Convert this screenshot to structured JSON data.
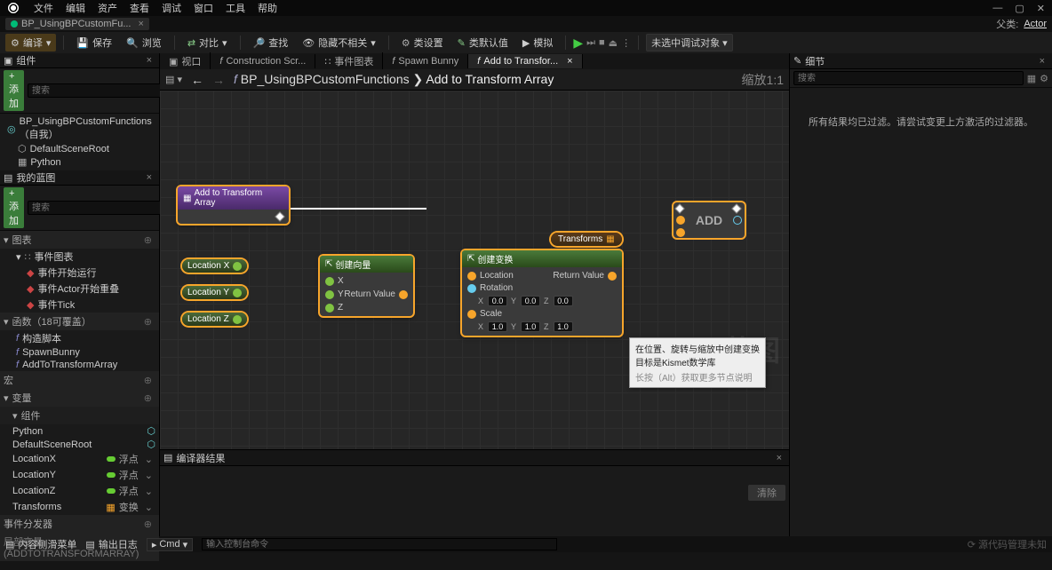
{
  "titlebar": {
    "menus": [
      "文件",
      "编辑",
      "资产",
      "查看",
      "调试",
      "窗口",
      "工具",
      "帮助"
    ],
    "tab_title": "BP_UsingBPCustomFu...",
    "parent_label": "父类:",
    "parent_value": "Actor"
  },
  "toolbar": {
    "compile": "编译",
    "save": "保存",
    "browse": "浏览",
    "diff": "对比",
    "find": "查找",
    "hide_unrelated": "隐藏不相关",
    "class_settings": "类设置",
    "class_defaults": "类默认值",
    "simulate": "模拟",
    "debug_dropdown": "未选中调试对象"
  },
  "components_panel": {
    "title": "组件",
    "add": "+ 添加",
    "search_placeholder": "搜索",
    "root": "BP_UsingBPCustomFunctions （自我）",
    "items": [
      {
        "name": "DefaultSceneRoot",
        "icon": "scene-root"
      },
      {
        "name": "Python",
        "icon": "python"
      }
    ]
  },
  "my_blueprint_panel": {
    "title": "我的蓝图",
    "add": "+ 添加",
    "search_placeholder": "搜索",
    "sections": {
      "graphs": "图表",
      "event_graph": "事件图表",
      "events": [
        "事件开始运行",
        "事件Actor开始重叠",
        "事件Tick"
      ],
      "functions": "函数（18可覆盖）",
      "func_items": [
        "构造脚本",
        "SpawnBunny",
        "AddToTransformArray"
      ],
      "macros": "宏",
      "vars": "变量",
      "components_hdr": "组件",
      "component_vars": [
        {
          "name": "Python",
          "type": "",
          "icon": "py-comp"
        },
        {
          "name": "DefaultSceneRoot",
          "type": "",
          "icon": "scene-comp"
        }
      ],
      "float_vars": [
        {
          "name": "LocationX",
          "type": "浮点"
        },
        {
          "name": "LocationY",
          "type": "浮点"
        },
        {
          "name": "LocationZ",
          "type": "浮点"
        }
      ],
      "transform_var": {
        "name": "Transforms",
        "type": "变换"
      },
      "dispatchers": "事件分发器",
      "local_vars": "局部变量 (ADDTOTRANSFORMARRAY)"
    }
  },
  "graph": {
    "tabs": [
      {
        "label": "视口",
        "icon": "viewport"
      },
      {
        "label": "Construction Scr...",
        "icon": "func"
      },
      {
        "label": "事件图表",
        "icon": "graph"
      },
      {
        "label": "Spawn Bunny",
        "icon": "func"
      },
      {
        "label": "Add to Transfor...",
        "icon": "func",
        "active": true
      }
    ],
    "breadcrumb_root": "BP_UsingBPCustomFunctions",
    "breadcrumb_leaf": "Add to Transform Array",
    "zoom": "缩放1:1",
    "watermark": "蓝图",
    "nodes": {
      "entry": {
        "title": "Add to Transform Array"
      },
      "locx": "Location X",
      "locy": "Location Y",
      "locz": "Location Z",
      "make_vector": {
        "title": "创建向量",
        "x": "X",
        "y": "Y",
        "z": "Z",
        "out": "Return Value"
      },
      "make_transform": {
        "title": "创建变换",
        "location": "Location",
        "rotation": "Rotation",
        "scale": "Scale",
        "out": "Return Value",
        "rot": {
          "x": "0.0",
          "y": "0.0",
          "z": "0.0"
        },
        "scl": {
          "x": "1.0",
          "y": "1.0",
          "z": "1.0"
        }
      },
      "transforms": "Transforms",
      "add": "ADD"
    },
    "tooltip": {
      "line1": "在位置、旋转与缩放中创建变换",
      "line2": "目标是Kismet数学库",
      "line3": "长按（Alt）获取更多节点说明"
    }
  },
  "compiler": {
    "title": "编译器结果",
    "clear": "清除"
  },
  "details": {
    "title": "细节",
    "search_placeholder": "搜索",
    "empty": "所有结果均已过滤。请尝试变更上方激活的过滤器。"
  },
  "bottombar": {
    "content": "内容侧滑菜单",
    "output": "输出日志",
    "cmd_label": "Cmd",
    "cmd_placeholder": "输入控制台命令",
    "source": "源代码管理未知"
  }
}
